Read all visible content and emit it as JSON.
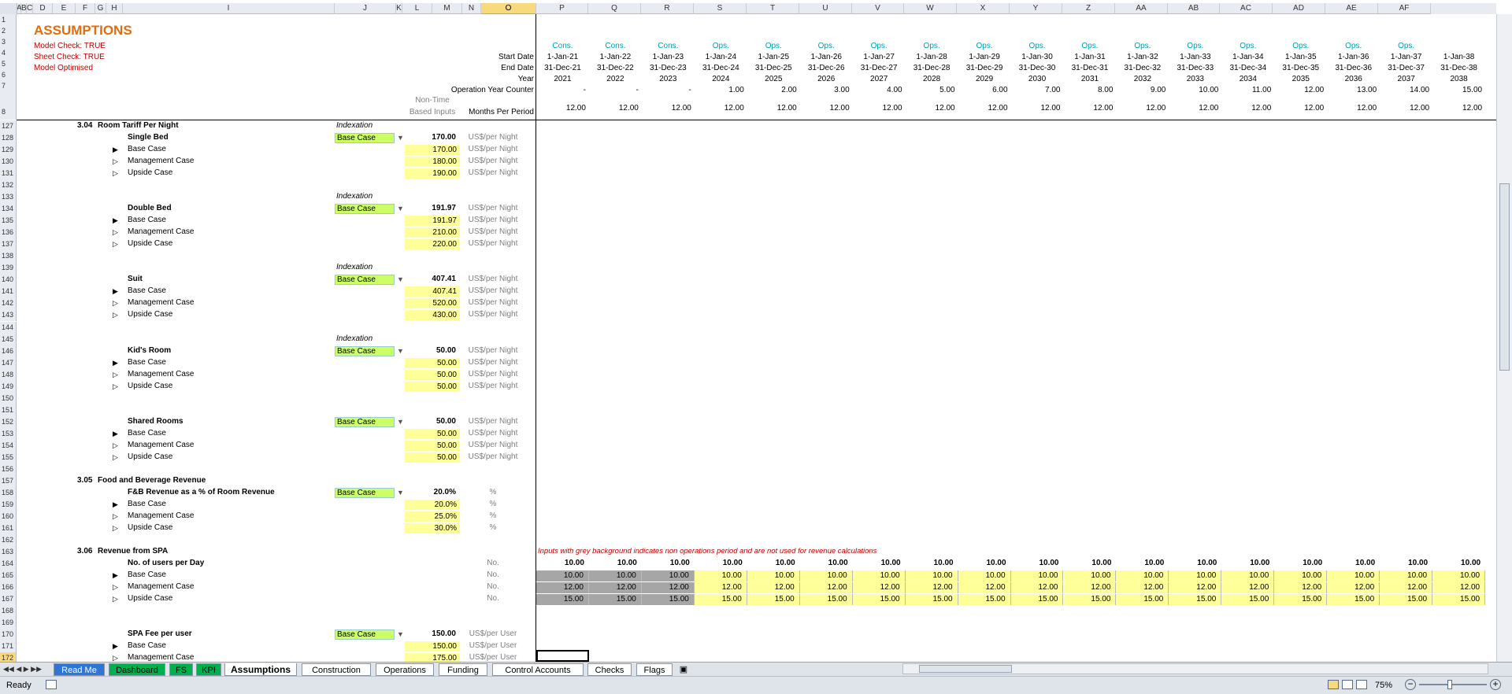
{
  "sheet_title": "ASSUMPTIONS",
  "checks": [
    "Model Check: TRUE",
    "Sheet Check: TRUE",
    "Model Optimised"
  ],
  "column_letters": [
    "A",
    "B",
    "C",
    "D",
    "E",
    "F",
    "G",
    "H",
    "I",
    "J",
    "K",
    "L",
    "M",
    "N",
    "O",
    "P",
    "Q",
    "R",
    "S",
    "T",
    "U",
    "V",
    "W",
    "X",
    "Y",
    "Z",
    "AA",
    "AB",
    "AC",
    "AD",
    "AE",
    "AF"
  ],
  "header_labels": {
    "start_date": "Start Date",
    "end_date": "End Date",
    "year": "Year",
    "op_year_counter": "Operation Year Counter",
    "non_time": "Non-Time",
    "based_inputs": "Based Inputs",
    "months_per_period": "Months Per Period"
  },
  "timeline": {
    "phase": [
      "Cons.",
      "Cons.",
      "Cons.",
      "Ops.",
      "Ops.",
      "Ops.",
      "Ops.",
      "Ops.",
      "Ops.",
      "Ops.",
      "Ops.",
      "Ops.",
      "Ops.",
      "Ops.",
      "Ops.",
      "Ops.",
      "Ops."
    ],
    "start": [
      "1-Jan-21",
      "1-Jan-22",
      "1-Jan-23",
      "1-Jan-24",
      "1-Jan-25",
      "1-Jan-26",
      "1-Jan-27",
      "1-Jan-28",
      "1-Jan-29",
      "1-Jan-30",
      "1-Jan-31",
      "1-Jan-32",
      "1-Jan-33",
      "1-Jan-34",
      "1-Jan-35",
      "1-Jan-36",
      "1-Jan-37",
      "1-Jan-38"
    ],
    "end": [
      "31-Dec-21",
      "31-Dec-22",
      "31-Dec-23",
      "31-Dec-24",
      "31-Dec-25",
      "31-Dec-26",
      "31-Dec-27",
      "31-Dec-28",
      "31-Dec-29",
      "31-Dec-30",
      "31-Dec-31",
      "31-Dec-32",
      "31-Dec-33",
      "31-Dec-34",
      "31-Dec-35",
      "31-Dec-36",
      "31-Dec-37",
      "31-Dec-38"
    ],
    "year": [
      "2021",
      "2022",
      "2023",
      "2024",
      "2025",
      "2026",
      "2027",
      "2028",
      "2029",
      "2030",
      "2031",
      "2032",
      "2033",
      "2034",
      "2035",
      "2036",
      "2037",
      "2038"
    ],
    "counter": [
      "-",
      "-",
      "-",
      "1.00",
      "2.00",
      "3.00",
      "4.00",
      "5.00",
      "6.00",
      "7.00",
      "8.00",
      "9.00",
      "10.00",
      "11.00",
      "12.00",
      "13.00",
      "14.00",
      "15.00"
    ],
    "months": [
      "12.00",
      "12.00",
      "12.00",
      "12.00",
      "12.00",
      "12.00",
      "12.00",
      "12.00",
      "12.00",
      "12.00",
      "12.00",
      "12.00",
      "12.00",
      "12.00",
      "12.00",
      "12.00",
      "12.00",
      "12.00"
    ]
  },
  "row_numbers": [
    "1",
    "2",
    "3",
    "4",
    "5",
    "6",
    "7",
    "8",
    "127",
    "128",
    "129",
    "130",
    "131",
    "132",
    "133",
    "134",
    "135",
    "136",
    "137",
    "138",
    "139",
    "140",
    "141",
    "142",
    "143",
    "144",
    "145",
    "146",
    "147",
    "148",
    "149",
    "150",
    "151",
    "152",
    "153",
    "154",
    "155",
    "156",
    "157",
    "158",
    "159",
    "160",
    "161",
    "162",
    "163",
    "164",
    "165",
    "166",
    "167",
    "168",
    "169",
    "170",
    "171",
    "172"
  ],
  "rows": {
    "s304": {
      "num": "3.04",
      "title": "Room Tariff Per Night"
    },
    "indexation": "Indexation",
    "base_case_sel": "Base Case",
    "single": {
      "name": "Single Bed",
      "value": "170.00",
      "cases": [
        "170.00",
        "180.00",
        "190.00"
      ]
    },
    "double": {
      "name": "Double Bed",
      "value": "191.97",
      "cases": [
        "191.97",
        "210.00",
        "220.00"
      ]
    },
    "suit": {
      "name": "Suit",
      "value": "407.41",
      "cases": [
        "407.41",
        "520.00",
        "430.00"
      ]
    },
    "kids": {
      "name": "Kid's Room",
      "value": "50.00",
      "cases": [
        "50.00",
        "50.00",
        "50.00"
      ]
    },
    "shared": {
      "name": "Shared Rooms",
      "value": "50.00",
      "cases": [
        "50.00",
        "50.00",
        "50.00"
      ]
    },
    "case_names": [
      "Base Case",
      "Management Case",
      "Upside Case"
    ],
    "unit_night": "US$/per Night",
    "s305": {
      "num": "3.05",
      "title": "Food and Beverage Revenue"
    },
    "fb": {
      "name": "F&B Revenue as a % of Room Revenue",
      "value": "20.0%",
      "cases": [
        "20.0%",
        "25.0%",
        "30.0%"
      ],
      "unit": "%"
    },
    "s306": {
      "num": "3.06",
      "title": "Revenue from SPA"
    },
    "note": "Inputs with grey background indicates non operations period and are not used for revenue calculations",
    "spa_users": {
      "name": "No. of users per Day",
      "unit": "No.",
      "top": "10.00",
      "cases": [
        "10.00",
        "12.00",
        "15.00"
      ]
    },
    "spa_fee": {
      "name": "SPA Fee per user",
      "value": "150.00",
      "cases": [
        "150.00",
        "175.00"
      ],
      "unit": "US$/per User"
    }
  },
  "tabs": [
    "Read Me",
    "Dashboard",
    "FS",
    "KPI",
    "Assumptions",
    "Construction",
    "Operations",
    "Funding",
    "Control Accounts",
    "Checks",
    "Flags"
  ],
  "tab_colors": [
    "#2e75d6",
    "#00b050",
    "#00b050",
    "#00b050",
    "#ffffff",
    "#ffffff",
    "#ffffff",
    "#ffffff",
    "#ffffff",
    "#ffffff",
    "#ffffff"
  ],
  "status": {
    "ready": "Ready",
    "zoom": "75%"
  }
}
